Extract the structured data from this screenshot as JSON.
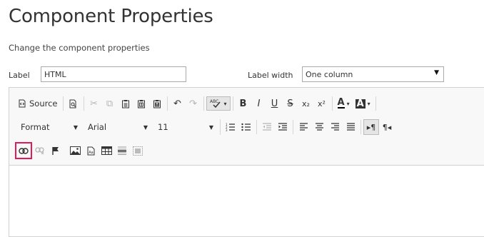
{
  "page": {
    "title": "Component Properties",
    "subtitle": "Change the component properties"
  },
  "form": {
    "label_caption": "Label",
    "label_value": "HTML",
    "label_width_caption": "Label width",
    "label_width_value": "One column"
  },
  "toolbar": {
    "source_label": "Source",
    "format_label": "Format",
    "font_label": "Arial",
    "size_label": "11",
    "glyphs": {
      "find": "⌕",
      "cut": "✂",
      "copy": "⧉",
      "paste": "📋",
      "undo": "↶",
      "redo": "↷",
      "spell": "ABC",
      "bold": "B",
      "italic": "I",
      "underline": "U",
      "strike": "S",
      "subscript": "x₂",
      "superscript": "x²",
      "text_color": "A",
      "bg_color": "A",
      "ol": "1≡",
      "ul": "•≡",
      "outdent": "⇤",
      "indent": "⇥",
      "align_left": "≡",
      "align_center": "≡",
      "align_right": "≡",
      "justify": "≣",
      "ltr": "▸¶",
      "rtl": "¶◂",
      "link": "🔗",
      "unlink": "⛓",
      "anchor": "⚑",
      "image": "▣",
      "flash": "🗎",
      "table": "▦",
      "hr": "☰",
      "iframe": "⬚"
    },
    "highlight_color": "#e21a5a"
  },
  "editor": {
    "content": ""
  }
}
